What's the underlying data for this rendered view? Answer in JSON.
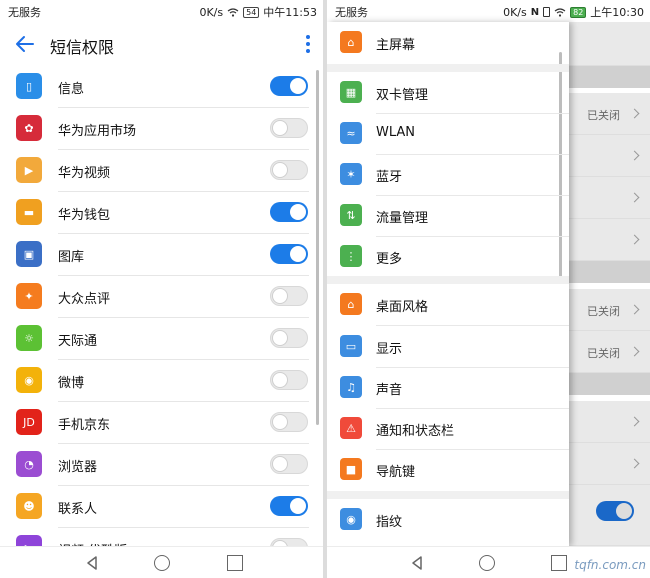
{
  "left_phone": {
    "status": {
      "carrier": "无服务",
      "speed": "0K/s",
      "battery": "54",
      "time": "中午11:53"
    },
    "appbar": {
      "title": "短信权限"
    },
    "items": [
      {
        "label": "信息",
        "on": true,
        "icon": "message-icon",
        "color": "#2a8ee8"
      },
      {
        "label": "华为应用市场",
        "on": false,
        "icon": "huawei-appgallery-icon",
        "color": "#d62b3a"
      },
      {
        "label": "华为视频",
        "on": false,
        "icon": "huawei-video-icon",
        "color": "#f2a93b"
      },
      {
        "label": "华为钱包",
        "on": true,
        "icon": "wallet-icon",
        "color": "#f0a020"
      },
      {
        "label": "图库",
        "on": true,
        "icon": "gallery-icon",
        "color": "#3b6fc6"
      },
      {
        "label": "大众点评",
        "on": false,
        "icon": "dianping-icon",
        "color": "#f57c1f"
      },
      {
        "label": "天际通",
        "on": false,
        "icon": "skytone-icon",
        "color": "#5cc134"
      },
      {
        "label": "微博",
        "on": false,
        "icon": "weibo-icon",
        "color": "#f3b20a"
      },
      {
        "label": "手机京东",
        "on": false,
        "icon": "jd-icon",
        "color": "#e2231a"
      },
      {
        "label": "浏览器",
        "on": false,
        "icon": "browser-icon",
        "color": "#9b4dd2"
      },
      {
        "label": "联系人",
        "on": true,
        "icon": "contacts-icon",
        "color": "#f5a623"
      },
      {
        "label": "视频 优酷版",
        "on": false,
        "icon": "youku-icon",
        "color": "#8e44d9"
      }
    ]
  },
  "right_phone": {
    "status": {
      "carrier": "无服务",
      "speed": "0K/s",
      "battery": "82",
      "time": "上午10:30"
    },
    "drawer": {
      "items": [
        {
          "label": "主屏幕",
          "icon": "home-icon",
          "color": "#f4791f"
        },
        {
          "label": "双卡管理",
          "icon": "sim-card-icon",
          "color": "#4cb050"
        },
        {
          "label": "WLAN",
          "icon": "wifi-icon",
          "color": "#3d8de0"
        },
        {
          "label": "蓝牙",
          "icon": "bluetooth-icon",
          "color": "#3d8de0"
        },
        {
          "label": "流量管理",
          "icon": "data-usage-icon",
          "color": "#4cb050"
        },
        {
          "label": "更多",
          "icon": "more-icon",
          "color": "#4cb050"
        },
        {
          "label": "桌面风格",
          "icon": "desktop-style-icon",
          "color": "#f4791f"
        },
        {
          "label": "显示",
          "icon": "display-icon",
          "color": "#3d8de0"
        },
        {
          "label": "声音",
          "icon": "sound-icon",
          "color": "#3d8de0"
        },
        {
          "label": "通知和状态栏",
          "icon": "notification-icon",
          "color": "#f04a3a"
        },
        {
          "label": "导航键",
          "icon": "navigation-key-icon",
          "color": "#f4791f"
        },
        {
          "label": "指纹",
          "icon": "fingerprint-icon",
          "color": "#3d8de0"
        }
      ]
    },
    "background": {
      "closed_label": "已关闭"
    }
  },
  "watermark": "tqfn.com.cn"
}
